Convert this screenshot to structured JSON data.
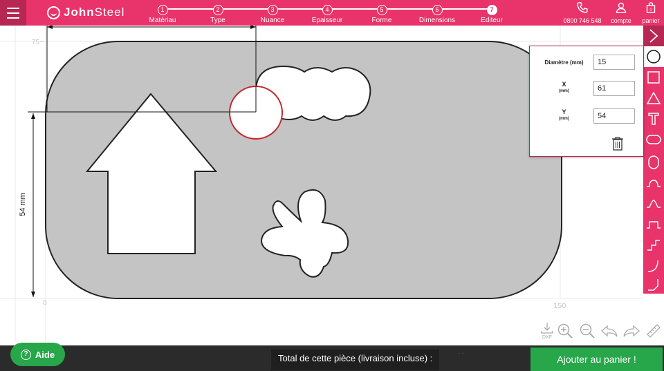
{
  "header": {
    "brand_first": "John",
    "brand_second": "Steel",
    "steps": [
      {
        "num": "1",
        "label": "Matériau"
      },
      {
        "num": "2",
        "label": "Type"
      },
      {
        "num": "3",
        "label": "Nuance"
      },
      {
        "num": "4",
        "label": "Epaisseur"
      },
      {
        "num": "5",
        "label": "Forme"
      },
      {
        "num": "6",
        "label": "Dimensions"
      },
      {
        "num": "7",
        "label": "Editeur"
      }
    ],
    "active_step": 7,
    "phone": "0800 746 548",
    "account_label": "compte",
    "cart_label": "panier"
  },
  "editor": {
    "ruler_top": "75",
    "axis_origin": "0",
    "axis_x_end": "150",
    "height_dimension": "54 mm",
    "shapes": [
      "rounded-rectangle-plate",
      "house-arrow-cutout",
      "cloud-cutout",
      "blob-cutout",
      "selected-circle"
    ]
  },
  "properties": {
    "diameter_label": "Diamètre (mm)",
    "diameter_value": "15",
    "x_label": "X",
    "x_unit": "(mm)",
    "x_value": "61",
    "y_label": "Y",
    "y_unit": "(mm)",
    "y_value": "54"
  },
  "toolbar_tools": [
    "chevron-right-icon",
    "circle-icon",
    "square-icon",
    "triangle-icon",
    "text-icon",
    "rounded-rect-icon",
    "rounded-bump-icon",
    "pointed-bump-icon",
    "notch-icon",
    "step-icon",
    "curve-corner-icon",
    "angle-corner-icon"
  ],
  "view_tools": {
    "dxf_label": "DXF",
    "icons": [
      "dxf-download-icon",
      "zoom-in-icon",
      "zoom-out-icon",
      "undo-icon",
      "redo-icon",
      "ruler-icon"
    ]
  },
  "footer": {
    "help_label": "Aide",
    "total_label": "Total de cette pièce (livraison incluse) :",
    "price_placeholder": "- -",
    "add_to_cart_label": "Ajouter au panier !"
  },
  "colors": {
    "brand": "#e8336b",
    "brand_dark": "#b72753",
    "plate": "#c4c4c4",
    "selection": "#c0272d",
    "success": "#27a64a",
    "footer": "#2b2b2b"
  }
}
